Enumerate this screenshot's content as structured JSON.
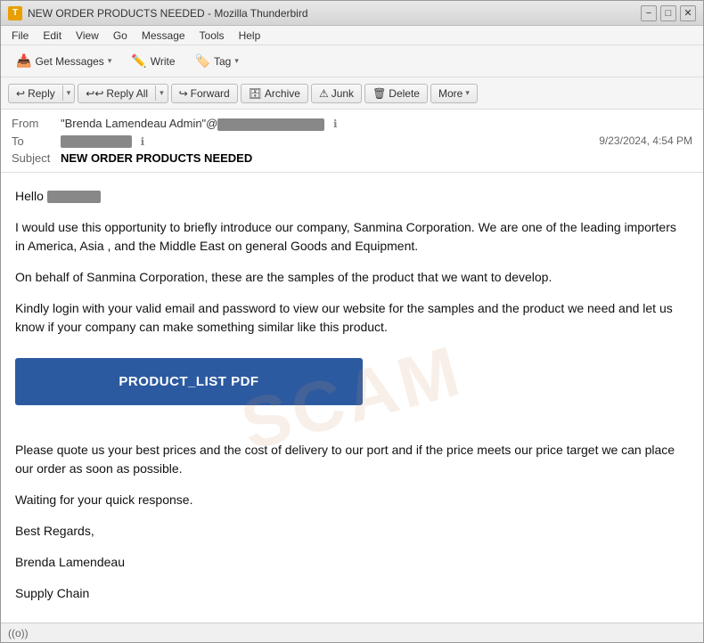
{
  "window": {
    "title": "NEW ORDER PRODUCTS NEEDED - Mozilla Thunderbird",
    "icon": "T"
  },
  "titlebar": {
    "minimize_label": "−",
    "maximize_label": "□",
    "close_label": "✕"
  },
  "menubar": {
    "items": [
      "File",
      "Edit",
      "View",
      "Go",
      "Message",
      "Tools",
      "Help"
    ]
  },
  "toolbar": {
    "get_messages_label": "Get Messages",
    "write_label": "Write",
    "tag_label": "Tag",
    "get_messages_icon": "📥",
    "write_icon": "✏️",
    "tag_icon": "🏷️"
  },
  "action_bar": {
    "reply_label": "Reply",
    "reply_all_label": "Reply All",
    "forward_label": "Forward",
    "archive_label": "Archive",
    "junk_label": "Junk",
    "delete_label": "Delete",
    "more_label": "More"
  },
  "email_header": {
    "from_label": "From",
    "from_value": "\"Brenda Lamendeau Admin\"@",
    "to_label": "To",
    "subject_label": "Subject",
    "subject_value": "NEW ORDER PRODUCTS NEEDED",
    "date_value": "9/23/2024, 4:54 PM"
  },
  "email_body": {
    "greeting": "Hello",
    "para1": "I would use this opportunity to briefly introduce our company, Sanmina Corporation.  We are one of the leading importers in America, Asia , and the Middle East on general Goods and Equipment.",
    "para2": "On behalf of Sanmina Corporation, these are the samples of the product that we want to develop.",
    "para3": "Kindly login with your valid email and password to view our website for the samples and the product we need and let us know if your company can make something similar like this product.",
    "product_btn_label": "PRODUCT_LIST PDF",
    "para4": "Please quote us your best prices and the cost of delivery to our port and if the price meets our price target we can place our order as soon as possible.",
    "para5": "Waiting for your quick response.",
    "para6": "Best Regards,",
    "para7": "Brenda Lamendeau",
    "para8": "Supply Chain"
  },
  "status_bar": {
    "icon": "((o))"
  }
}
